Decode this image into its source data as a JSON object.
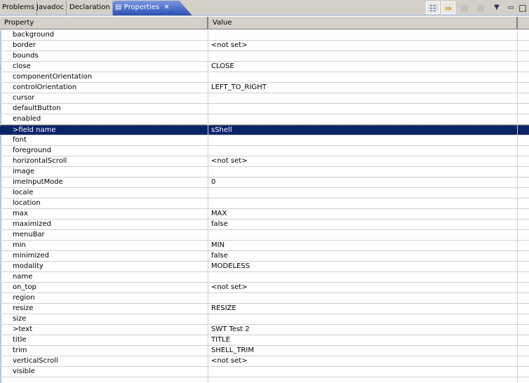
{
  "tabs": [
    {
      "label": "Problems"
    },
    {
      "label": "Javadoc"
    },
    {
      "label": "Declaration"
    },
    {
      "label": "Properties",
      "active": true
    }
  ],
  "toolbar": [
    "show-categories-icon",
    "show-advanced-icon",
    "restore-default-icon",
    "restore-value-icon",
    "view-menu-icon",
    "minimize-icon",
    "maximize-icon"
  ],
  "columns": {
    "property": "Property",
    "value": "Value"
  },
  "selected_index": 9,
  "rows": [
    {
      "p": "background",
      "v": ""
    },
    {
      "p": "border",
      "v": "<not set>"
    },
    {
      "p": "bounds",
      "v": ""
    },
    {
      "p": "close",
      "v": "CLOSE"
    },
    {
      "p": "componentOrientation",
      "v": ""
    },
    {
      "p": "controlOrientation",
      "v": "LEFT_TO_RIGHT"
    },
    {
      "p": "cursor",
      "v": ""
    },
    {
      "p": "defaultButton",
      "v": ""
    },
    {
      "p": "enabled",
      "v": ""
    },
    {
      "p": ">field name",
      "v": "sShell"
    },
    {
      "p": "font",
      "v": ""
    },
    {
      "p": "foreground",
      "v": ""
    },
    {
      "p": "horizontalScroll",
      "v": "<not set>"
    },
    {
      "p": "image",
      "v": ""
    },
    {
      "p": "imeInputMode",
      "v": "0"
    },
    {
      "p": "locale",
      "v": ""
    },
    {
      "p": "location",
      "v": ""
    },
    {
      "p": "max",
      "v": "MAX"
    },
    {
      "p": "maximized",
      "v": "false"
    },
    {
      "p": "menuBar",
      "v": ""
    },
    {
      "p": "min",
      "v": "MIN"
    },
    {
      "p": "minimized",
      "v": "false"
    },
    {
      "p": "modality",
      "v": "MODELESS"
    },
    {
      "p": "name",
      "v": ""
    },
    {
      "p": "on_top",
      "v": "<not set>"
    },
    {
      "p": "region",
      "v": ""
    },
    {
      "p": "resize",
      "v": "RESIZE"
    },
    {
      "p": "size",
      "v": ""
    },
    {
      "p": ">text",
      "v": "SWT Test 2"
    },
    {
      "p": "title",
      "v": "TITLE"
    },
    {
      "p": "trim",
      "v": "SHELL_TRIM"
    },
    {
      "p": "verticalScroll",
      "v": "<not set>"
    },
    {
      "p": "visible",
      "v": ""
    }
  ]
}
